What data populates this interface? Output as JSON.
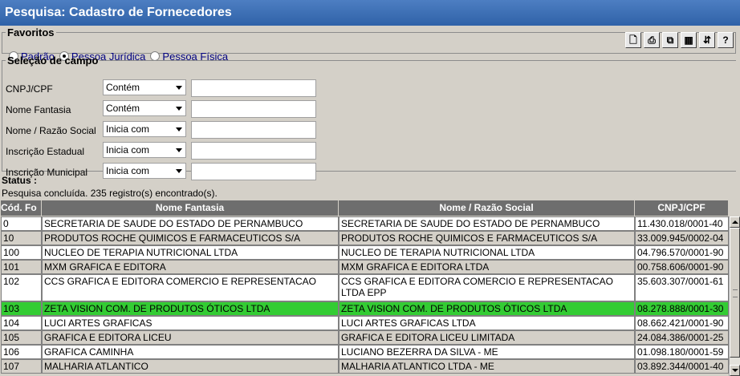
{
  "window": {
    "title": "Pesquisa: Cadastro de Fornecedores"
  },
  "favoritos": {
    "legend": "Favoritos",
    "options": [
      {
        "label": "Padrão",
        "selected": false
      },
      {
        "label": "Pessoa Jurídica",
        "selected": true
      },
      {
        "label": "Pessoa Física",
        "selected": false
      }
    ]
  },
  "toolbar": {
    "buttons": [
      {
        "icon": "new-document-icon"
      },
      {
        "icon": "print-icon"
      },
      {
        "icon": "copy-icon"
      },
      {
        "icon": "columns-icon"
      },
      {
        "icon": "export-icon"
      },
      {
        "icon": "help-icon",
        "glyph": "?"
      }
    ]
  },
  "selecao": {
    "legend": "Seleção de campo",
    "fields": [
      {
        "label": "CNPJ/CPF",
        "operator": "Contém",
        "value": ""
      },
      {
        "label": "Nome Fantasia",
        "operator": "Contém",
        "value": ""
      },
      {
        "label": "Nome / Razão Social",
        "operator": "Inicia com",
        "value": ""
      },
      {
        "label": "Inscrição Estadual",
        "operator": "Inicia com",
        "value": ""
      },
      {
        "label": "Inscrição Municipal",
        "operator": "Inicia com",
        "value": ""
      }
    ]
  },
  "status": {
    "label": "Status :",
    "text": "Pesquisa concluída. 235 registro(s) encontrado(s)."
  },
  "grid": {
    "columns": [
      "Cód. Fo",
      "Nome Fantasia",
      "Nome / Razão Social",
      "CNPJ/CPF"
    ],
    "selected_color": "#33cc33",
    "rows": [
      [
        "0",
        "SECRETARIA DE SAUDE DO ESTADO DE PERNAMBUCO",
        "SECRETARIA DE SAUDE DO ESTADO DE PERNAMBUCO",
        "11.430.018/0001-40"
      ],
      [
        "10",
        "PRODUTOS ROCHE QUIMICOS E FARMACEUTICOS S/A",
        "PRODUTOS ROCHE QUIMICOS E FARMACEUTICOS S/A",
        "33.009.945/0002-04"
      ],
      [
        "100",
        "NUCLEO DE TERAPIA NUTRICIONAL LTDA",
        "NUCLEO DE TERAPIA NUTRICIONAL LTDA",
        "04.796.570/0001-90"
      ],
      [
        "101",
        "MXM GRAFICA E EDITORA",
        "MXM GRAFICA E EDITORA LTDA",
        "00.758.606/0001-90"
      ],
      [
        "102",
        "CCS GRAFICA E EDITORA COMERCIO E REPRESENTACAO",
        "CCS GRAFICA E EDITORA COMERCIO E REPRESENTACAO LTDA EPP",
        "35.603.307/0001-61"
      ],
      [
        "103",
        "ZETA VISION COM. DE PRODUTOS ÓTICOS LTDA",
        "ZETA VISION COM. DE PRODUTOS ÓTICOS LTDA",
        "08.278.888/0001-30"
      ],
      [
        "104",
        "LUCI ARTES GRAFICAS",
        "LUCI ARTES GRAFICAS LTDA",
        "08.662.421/0001-90"
      ],
      [
        "105",
        "GRAFICA E EDITORA LICEU",
        "GRAFICA E EDITORA LICEU LIMITADA",
        "24.084.386/0001-25"
      ],
      [
        "106",
        "GRAFICA CAMINHA",
        "LUCIANO BEZERRA DA SILVA - ME",
        "01.098.180/0001-59"
      ],
      [
        "107",
        "MALHARIA ATLANTICO",
        "MALHARIA ATLANTICO LTDA - ME",
        "03.892.344/0001-40"
      ]
    ]
  }
}
